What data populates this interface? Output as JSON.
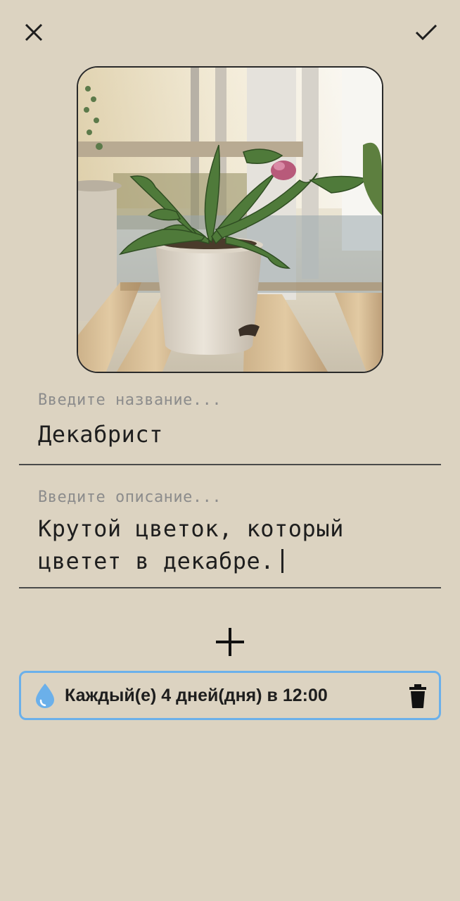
{
  "toolbar": {
    "close_icon": "close-icon",
    "confirm_icon": "check-icon"
  },
  "form": {
    "name": {
      "placeholder": "Введите название...",
      "value": "Декабрист"
    },
    "description": {
      "placeholder": "Введите описание...",
      "line1": "Крутой цветок, который",
      "line2": "цветет в декабре."
    }
  },
  "add_button_icon": "plus-icon",
  "schedules": [
    {
      "icon": "water-drop-icon",
      "text": "Каждый(е) 4 дней(дня) в 12:00",
      "delete_icon": "trash-icon"
    }
  ],
  "colors": {
    "background": "#DCD3C1",
    "accent": "#6BB0EA",
    "text": "#1E1E1E",
    "hint": "#8C8C8C"
  }
}
